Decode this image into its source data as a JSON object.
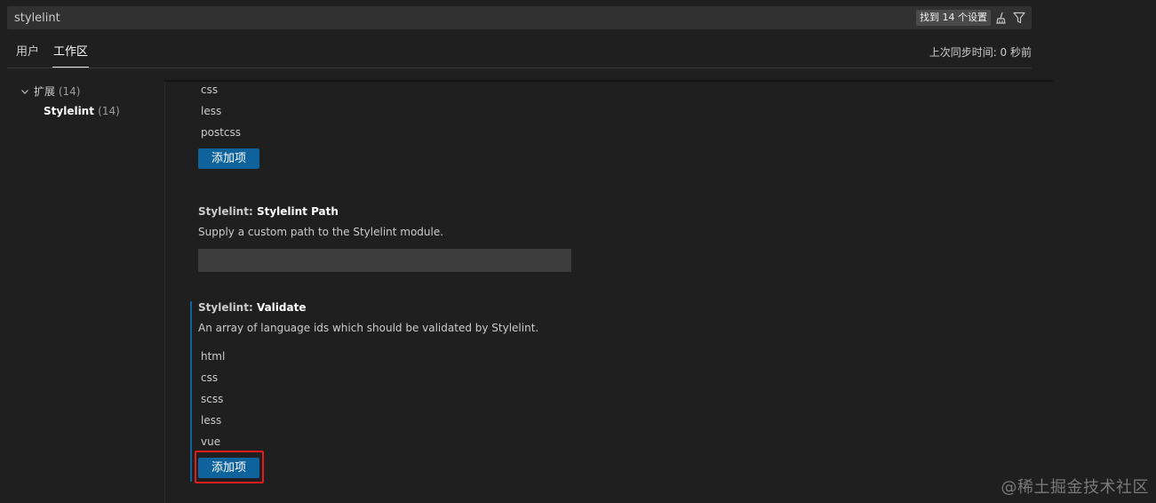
{
  "search": {
    "value": "stylelint",
    "result_count_label": "找到 14 个设置"
  },
  "tabs": [
    {
      "label": "用户"
    },
    {
      "label": "工作区"
    }
  ],
  "sync_status": "上次同步时间: 0 秒前",
  "toc": {
    "group_label": "扩展",
    "group_count": "(14)",
    "item_label": "Stylelint",
    "item_count": "(14)"
  },
  "settings": {
    "snippet_languages": [
      "css",
      "less",
      "postcss"
    ],
    "add_item_label": "添加项",
    "stylelint_path": {
      "category": "Stylelint: ",
      "name": "Stylelint Path",
      "description": "Supply a custom path to the Stylelint module.",
      "value": ""
    },
    "validate": {
      "category": "Stylelint: ",
      "name": "Validate",
      "description": "An array of language ids which should be validated by Stylelint.",
      "items": [
        "html",
        "css",
        "scss",
        "less",
        "vue"
      ]
    }
  },
  "watermark": "@稀土掘金技术社区",
  "icons": {
    "clear": "clear-all-icon",
    "filter": "filter-icon",
    "chevron": "chevron-down-icon"
  },
  "colors": {
    "background": "#1f1f1f",
    "button": "#0e639c",
    "highlight": "#e01c1c",
    "input_background": "#3c3c3c"
  }
}
